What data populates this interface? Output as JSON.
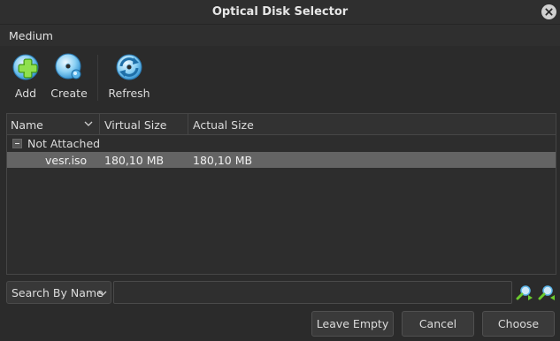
{
  "window": {
    "title": "Optical Disk Selector"
  },
  "menu": {
    "items": [
      "Medium"
    ]
  },
  "toolbar": {
    "add_label": "Add",
    "create_label": "Create",
    "refresh_label": "Refresh",
    "icons": {
      "add": "disc-add-icon",
      "create": "disc-create-icon",
      "refresh": "refresh-icon"
    }
  },
  "table": {
    "columns": [
      "Name",
      "Virtual Size",
      "Actual Size"
    ],
    "groups": [
      {
        "label": "Not Attached",
        "expanded": true,
        "rows": [
          {
            "name": "vesr.iso",
            "virtual_size": "180,10 MB",
            "actual_size": "180,10 MB",
            "selected": true
          }
        ]
      }
    ]
  },
  "search": {
    "mode": "Search By Name",
    "value": "",
    "placeholder": ""
  },
  "buttons": {
    "leave_empty": "Leave Empty",
    "cancel": "Cancel",
    "choose": "Choose"
  },
  "colors": {
    "accent_blue": "#5ab4e8",
    "add_green": "#7fd03a",
    "selection": "#646464"
  }
}
